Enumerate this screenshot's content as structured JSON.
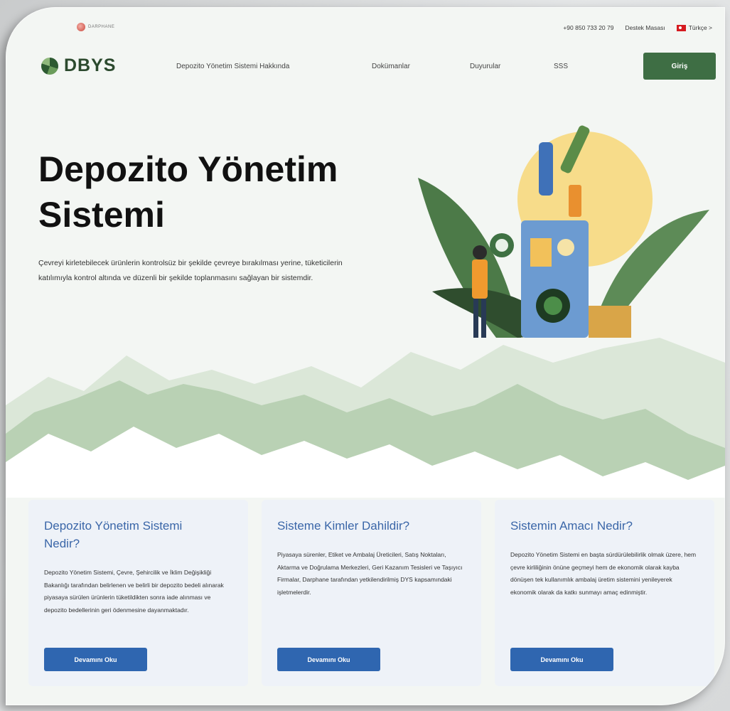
{
  "topbar": {
    "brand": "DARPHANE",
    "phone": "+90 850 733 20 79",
    "support": "Destek Masası",
    "language": "Türkçe >"
  },
  "nav": {
    "logo": "DBYS",
    "links": [
      "Depozito Yönetim Sistemi Hakkında",
      "Dokümanlar",
      "Duyurular",
      "SSS"
    ],
    "login": "Giriş"
  },
  "hero": {
    "title": "Depozito Yönetim Sistemi",
    "description": "Çevreyi kirletebilecek ürünlerin kontrolsüz bir şekilde çevreye bırakılması yerine, tüketicilerin katılımıyla kontrol altında ve düzenli bir şekilde toplanmasını sağlayan bir sistemdir."
  },
  "cards": [
    {
      "title": "Depozito Yönetim Sistemi Nedir?",
      "body": "Depozito Yönetim Sistemi, Çevre, Şehircilik ve İklim Değişikliği Bakanlığı tarafından belirlenen ve belirli bir depozito bedeli alınarak piyasaya sürülen ürünlerin tüketildikten sonra iade alınması ve depozito bedellerinin geri ödenmesine dayanmaktadır.",
      "button": "Devamını Oku"
    },
    {
      "title": "Sisteme Kimler Dahildir?",
      "body": "Piyasaya sürenler, Etiket ve Ambalaj Üreticileri, Satış Noktaları, Aktarma ve Doğrulama Merkezleri, Geri Kazanım Tesisleri ve Taşıyıcı Firmalar, Darphane tarafından yetkilendirilmiş DYS kapsamındaki işletmelerdir.",
      "button": "Devamını Oku"
    },
    {
      "title": "Sistemin Amacı Nedir?",
      "body": "Depozito Yönetim Sistemi en başta sürdürülebilirlik olmak üzere, hem çevre kirliliğinin önüne geçmeyi hem de ekonomik olarak kayba dönüşen tek kullanımlık ambalaj üretim sistemini yenileyerek ekonomik olarak da katkı sunmayı amaç edinmiştir.",
      "button": "Devamını Oku"
    }
  ],
  "colors": {
    "brand_green": "#3e6e44",
    "accent_blue": "#2f66b0",
    "card_title": "#3a66a8",
    "card_bg": "#eef2f8"
  }
}
